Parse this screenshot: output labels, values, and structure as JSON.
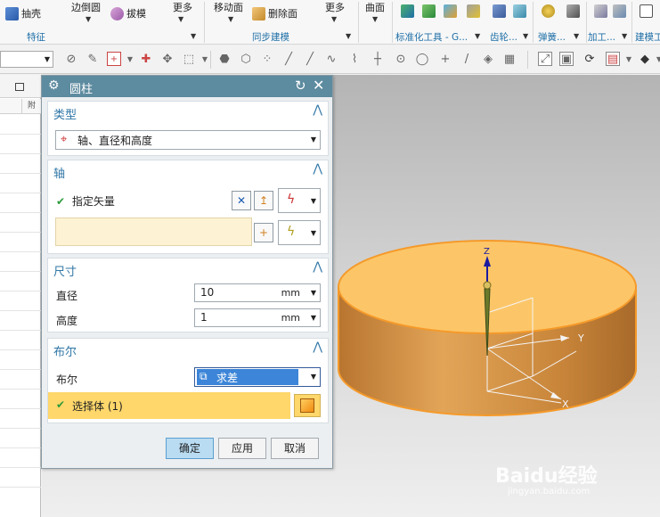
{
  "ribbon": {
    "items": {
      "shell": "抽壳",
      "edge_round": "边倒圆",
      "draft": "拔模",
      "more1": "更多",
      "move_face": "移动面",
      "delete_face": "删除面",
      "more2": "更多",
      "surface": "曲面"
    },
    "groups": {
      "feature": "特征",
      "sync_modeling": "同步建模",
      "std_tools": "标准化工具 - G...",
      "gear": "齿轮...",
      "spring": "弹簧...",
      "machining": "加工...",
      "modeling_tools": "建模工"
    }
  },
  "dialog": {
    "title": "圆柱",
    "sections": {
      "type": {
        "title": "类型",
        "value": "轴、直径和高度"
      },
      "axis": {
        "title": "轴",
        "specify_vector": "指定矢量"
      },
      "dimensions": {
        "title": "尺寸",
        "diameter_label": "直径",
        "diameter_value": "10",
        "diameter_unit": "mm",
        "height_label": "高度",
        "height_value": "1",
        "height_unit": "mm"
      },
      "boolean": {
        "title": "布尔",
        "label": "布尔",
        "value": "求差",
        "select_body": "选择体 (1)"
      }
    },
    "buttons": {
      "ok": "确定",
      "apply": "应用",
      "cancel": "取消"
    }
  },
  "viewport": {
    "axes": {
      "x": "X",
      "y": "Y",
      "z": "Z"
    }
  },
  "watermark": {
    "logo": "Baidu经验",
    "url": "jingyan.baidu.com"
  },
  "colors": {
    "title_bar": "#5d8b9f",
    "section_title": "#2f76a6",
    "cylinder_top": "#fcc668",
    "cylinder_side": "#c8873c",
    "selection_highlight": "#ffd76b"
  }
}
